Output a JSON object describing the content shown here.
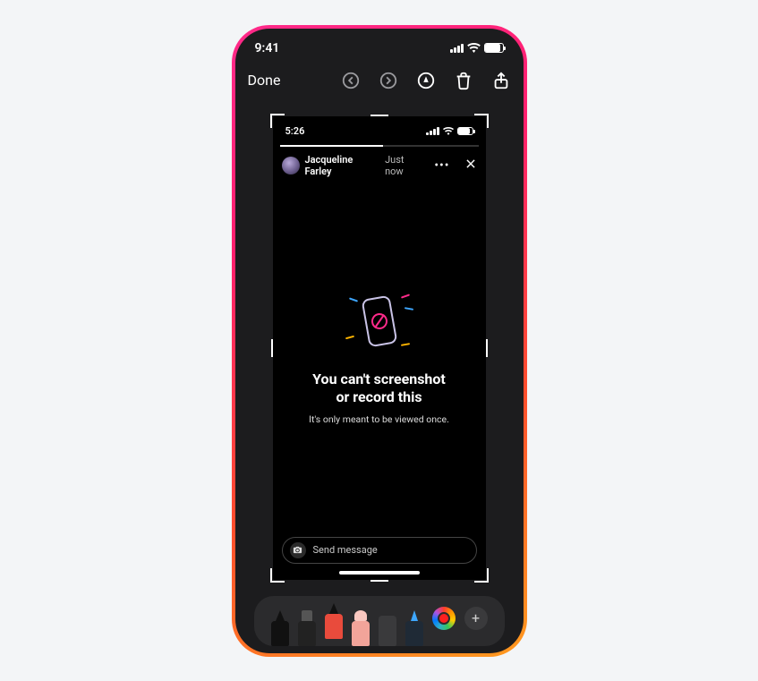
{
  "outer_status": {
    "time": "9:41"
  },
  "toolbar": {
    "done_label": "Done"
  },
  "inner_status": {
    "time": "5:26"
  },
  "story": {
    "user_name": "Jacqueline Farley",
    "timestamp": "Just now",
    "more_label": "•••"
  },
  "blocked": {
    "title_line1": "You can't screenshot",
    "title_line2": "or record this",
    "subtitle": "It's only meant to be viewed once."
  },
  "message_input": {
    "placeholder": "Send message"
  },
  "colors": {
    "selected_swatch": "#ff1f1f"
  }
}
